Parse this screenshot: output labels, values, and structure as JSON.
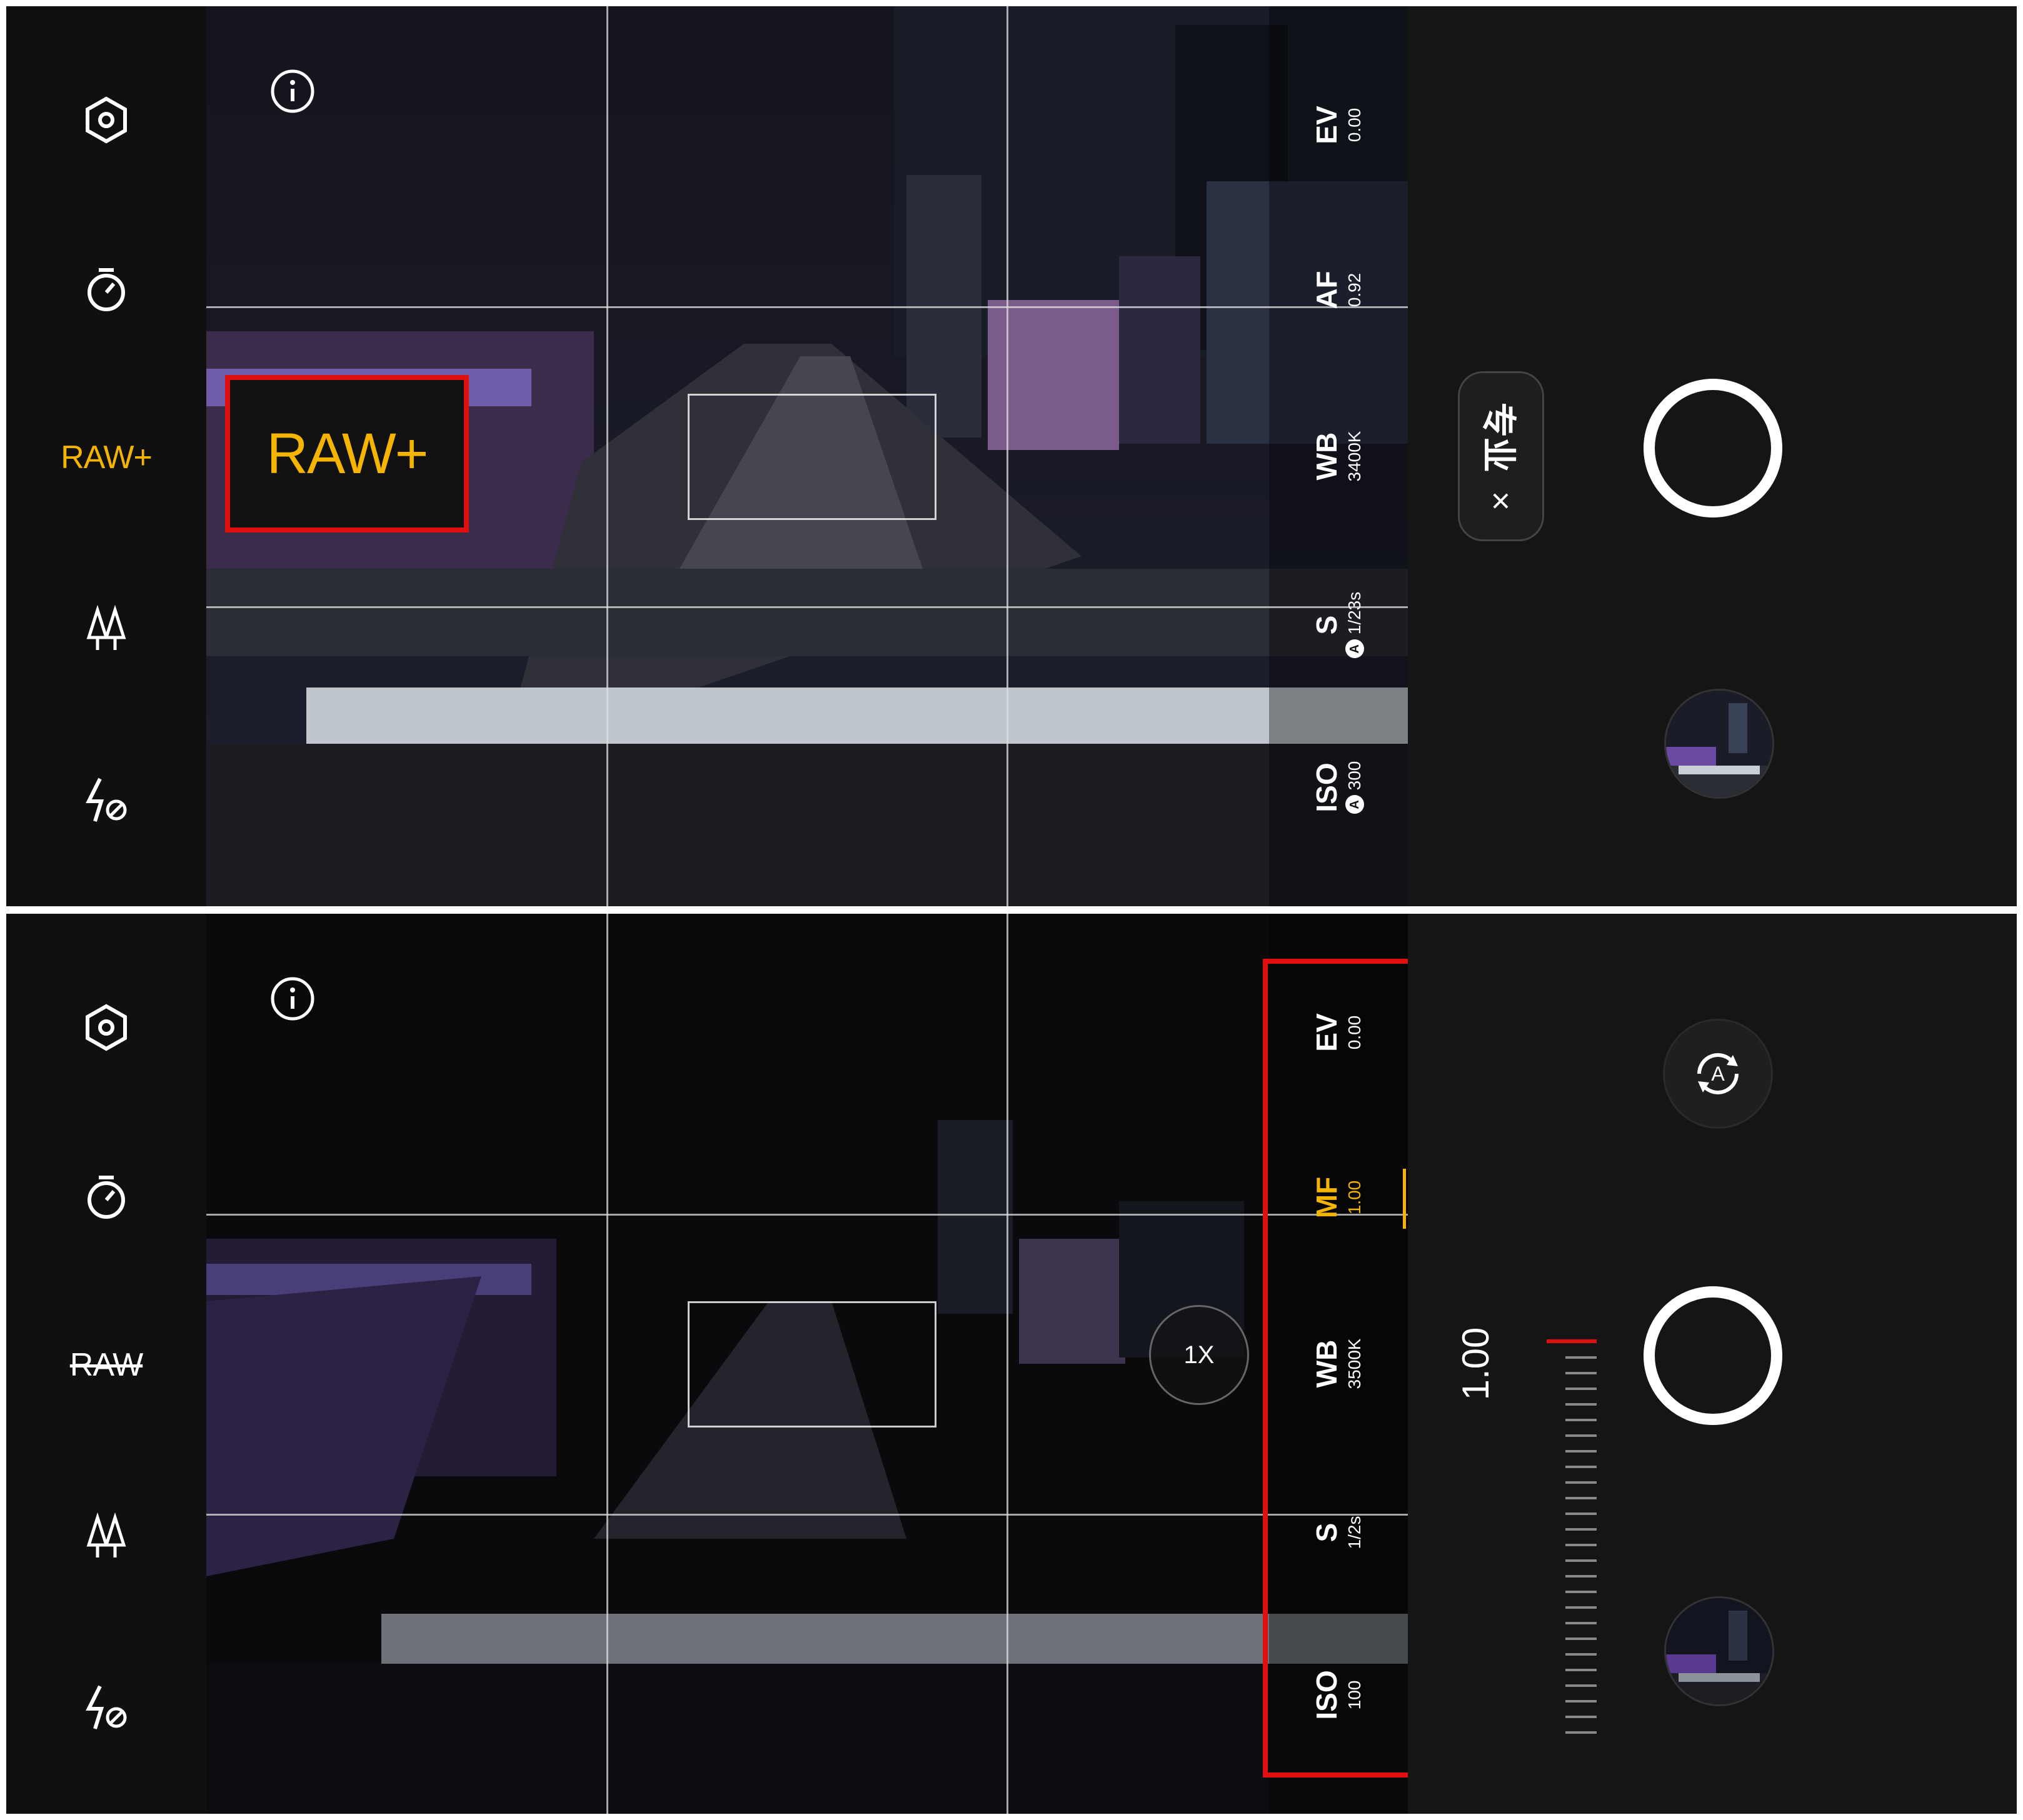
{
  "top_screen": {
    "sidebar": {
      "settings_icon": "hexagon-settings-icon",
      "timer_icon": "timer-icon",
      "raw_label": "RAW+",
      "filter_icon": "tree-filter-icon",
      "flash_icon": "flash-off-icon"
    },
    "params": [
      {
        "name": "EV",
        "value": "0.00",
        "auto": false
      },
      {
        "name": "AF",
        "value": "0.92",
        "auto": false
      },
      {
        "name": "WB",
        "value": "3400K",
        "auto": false
      },
      {
        "name": "S",
        "value": "1/23s",
        "auto": true
      },
      {
        "name": "ISO",
        "value": "300",
        "auto": true
      }
    ],
    "mode_pill": {
      "label": "专业",
      "close": "×"
    },
    "raw_callout": "RAW+",
    "auto_badge": "A"
  },
  "bottom_screen": {
    "sidebar": {
      "settings_icon": "hexagon-settings-icon",
      "timer_icon": "timer-icon",
      "raw_label": "RAW",
      "filter_icon": "tree-filter-icon",
      "flash_icon": "flash-off-icon"
    },
    "params": [
      {
        "name": "EV",
        "value": "0.00"
      },
      {
        "name": "MF",
        "value": "1.00",
        "active": true
      },
      {
        "name": "WB",
        "value": "3500K"
      },
      {
        "name": "S",
        "value": "1/2s"
      },
      {
        "name": "ISO",
        "value": "100"
      }
    ],
    "zoom": "1X",
    "mf_readout": "1.00",
    "auto_button": "A"
  },
  "colors": {
    "accent": "#f5b400",
    "highlight": "#e11010"
  }
}
